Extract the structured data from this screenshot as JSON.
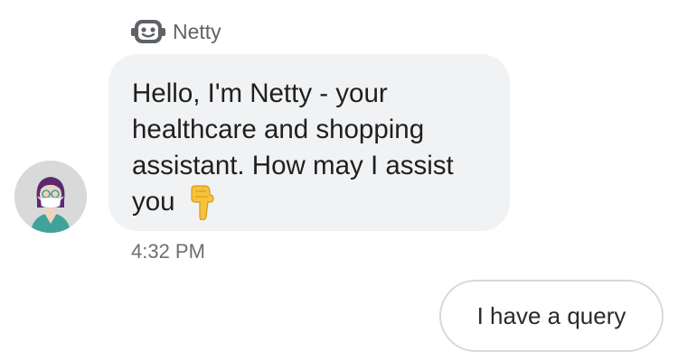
{
  "chat": {
    "sender_name": "Netty",
    "message": {
      "text": "Hello, I'm Netty - your healthcare and shopping assistant. How may I assist you",
      "emoji": "pointing-down-hand-icon",
      "timestamp": "4:32 PM"
    },
    "quick_reply": {
      "label": "I have a query"
    }
  },
  "colors": {
    "bubble_background": "#f1f2f4",
    "avatar_background": "#d9d9d9",
    "quick_reply_border": "#d6d8db",
    "secondary_text": "#6b6f73"
  }
}
